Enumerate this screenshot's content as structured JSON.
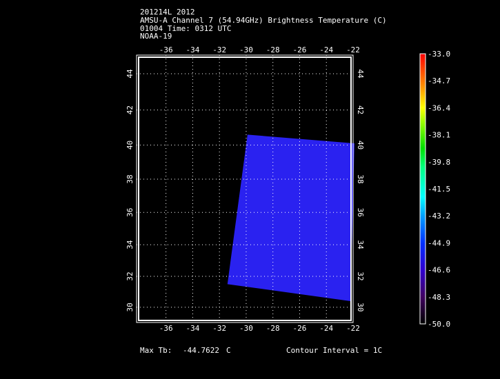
{
  "title_lines": [
    "201214L 2012",
    "AMSU-A Channel 7 (54.94GHz) Brightness Temperature (C)",
    "01004 Time: 0312 UTC",
    "NOAA-19"
  ],
  "footer": {
    "max_label": "Max Tb:",
    "max_value": "-44.7622",
    "max_unit": "C",
    "contour": "Contour Interval = 1C"
  },
  "chart_data": {
    "type": "heatmap",
    "title": "AMSU-A Channel 7 (54.94GHz) Brightness Temperature (C)",
    "x_ticks": [
      "-36",
      "-34",
      "-32",
      "-30",
      "-28",
      "-26",
      "-24",
      "-22"
    ],
    "x_tick_values": [
      -36,
      -34,
      -32,
      -30,
      -28,
      -26,
      -24,
      -22
    ],
    "y_ticks": [
      "44",
      "42",
      "40",
      "38",
      "36",
      "34",
      "32",
      "30"
    ],
    "y_tick_values": [
      44,
      42,
      40,
      38,
      36,
      34,
      32,
      30
    ],
    "xlim": [
      -38.2,
      -22
    ],
    "ylim": [
      29,
      45
    ],
    "grid": true,
    "swath_corners_lonlat": [
      [
        -29.9,
        40.6
      ],
      [
        -21.9,
        40.1
      ],
      [
        -22.2,
        30.4
      ],
      [
        -31.4,
        31.5
      ]
    ],
    "swath_value_range": [
      -47.0,
      -44.8
    ],
    "colorbar": {
      "min": -50.0,
      "max": -33.0,
      "labels": [
        "-33.0",
        "-34.7",
        "-36.4",
        "-38.1",
        "-39.8",
        "-41.5",
        "-43.2",
        "-44.9",
        "-46.6",
        "-48.3",
        "-50.0"
      ]
    },
    "swath_color": "#2a22f0"
  }
}
